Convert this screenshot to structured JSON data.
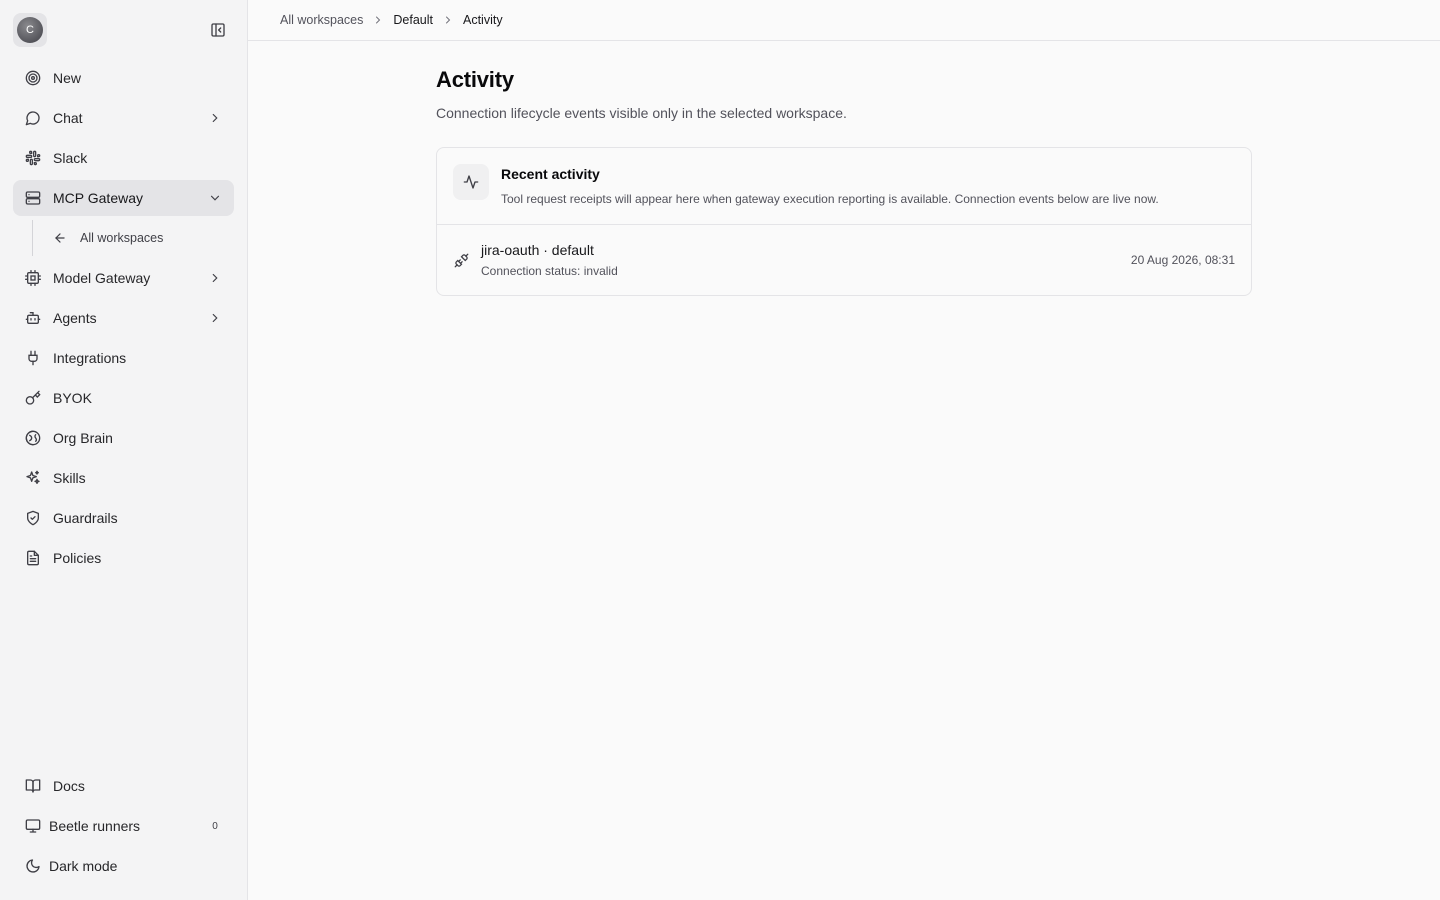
{
  "sidebar": {
    "avatar_initial": "C",
    "items": [
      {
        "label": "New",
        "icon": "target-icon"
      },
      {
        "label": "Chat",
        "icon": "chat-bubble-icon",
        "has_chevron": true
      },
      {
        "label": "Slack",
        "icon": "slack-icon"
      },
      {
        "label": "MCP Gateway",
        "icon": "server-icon",
        "expanded": true
      },
      {
        "label": "Model Gateway",
        "icon": "cpu-icon",
        "has_chevron": true
      },
      {
        "label": "Agents",
        "icon": "bot-icon",
        "has_chevron": true
      },
      {
        "label": "Integrations",
        "icon": "plug-icon"
      },
      {
        "label": "BYOK",
        "icon": "key-icon"
      },
      {
        "label": "Org Brain",
        "icon": "brain-icon"
      },
      {
        "label": "Skills",
        "icon": "sparkles-icon"
      },
      {
        "label": "Guardrails",
        "icon": "shield-check-icon"
      },
      {
        "label": "Policies",
        "icon": "file-text-icon"
      }
    ],
    "sub_item": {
      "label": "All workspaces",
      "icon": "arrow-left-icon"
    },
    "bottom": {
      "docs": "Docs",
      "runners": "Beetle runners",
      "runners_count": "0",
      "dark_mode": "Dark mode"
    }
  },
  "breadcrumb": {
    "root": "All workspaces",
    "workspace": "Default",
    "current": "Activity"
  },
  "page": {
    "title": "Activity",
    "subtitle": "Connection lifecycle events visible only in the selected workspace."
  },
  "card": {
    "title": "Recent activity",
    "description": "Tool request receipts will appear here when gateway execution reporting is available. Connection events below are live now.",
    "events": [
      {
        "name": "jira-oauth · default",
        "status": "Connection status: invalid",
        "time": "20 Aug 2026, 08:31"
      }
    ]
  }
}
